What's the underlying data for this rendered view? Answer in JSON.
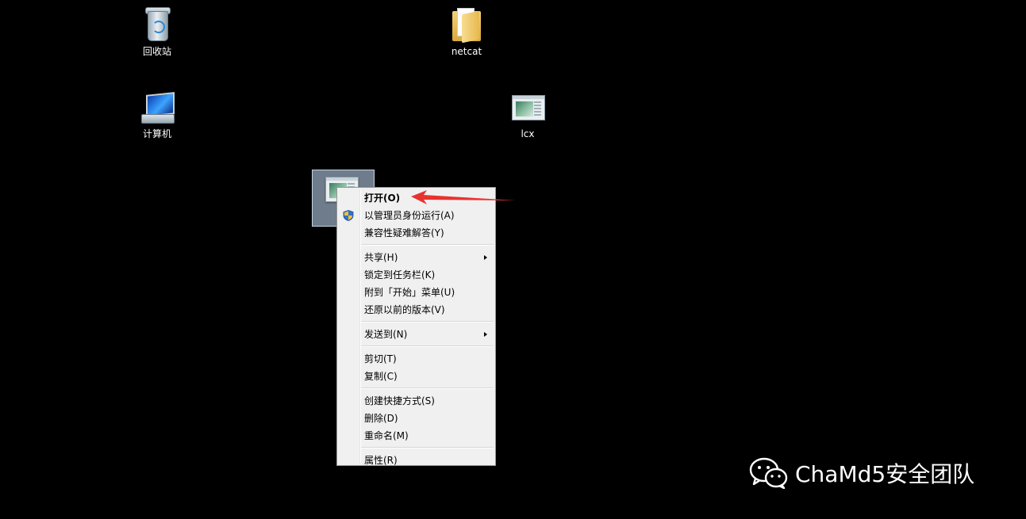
{
  "desktop": {
    "icons": [
      {
        "label": "回收站",
        "icon": "recycle-bin-icon"
      },
      {
        "label": "netcat",
        "icon": "folder-icon"
      },
      {
        "label": "计算机",
        "icon": "computer-icon"
      },
      {
        "label": "lcx",
        "icon": "application-window-icon"
      }
    ]
  },
  "context_menu": {
    "groups": [
      [
        {
          "label": "打开(O)",
          "bold": true
        },
        {
          "label": "以管理员身份运行(A)",
          "icon": "uac-shield-icon"
        },
        {
          "label": "兼容性疑难解答(Y)"
        }
      ],
      [
        {
          "label": "共享(H)",
          "submenu": true
        },
        {
          "label": "锁定到任务栏(K)"
        },
        {
          "label": "附到「开始」菜单(U)"
        },
        {
          "label": "还原以前的版本(V)"
        }
      ],
      [
        {
          "label": "发送到(N)",
          "submenu": true
        }
      ],
      [
        {
          "label": "剪切(T)"
        },
        {
          "label": "复制(C)"
        }
      ],
      [
        {
          "label": "创建快捷方式(S)"
        },
        {
          "label": "删除(D)"
        },
        {
          "label": "重命名(M)"
        }
      ],
      [
        {
          "label": "属性(R)"
        }
      ]
    ]
  },
  "annotation": {
    "color": "#e8322f"
  },
  "watermark": {
    "text": "ChaMd5安全团队",
    "icon": "wechat-icon"
  }
}
